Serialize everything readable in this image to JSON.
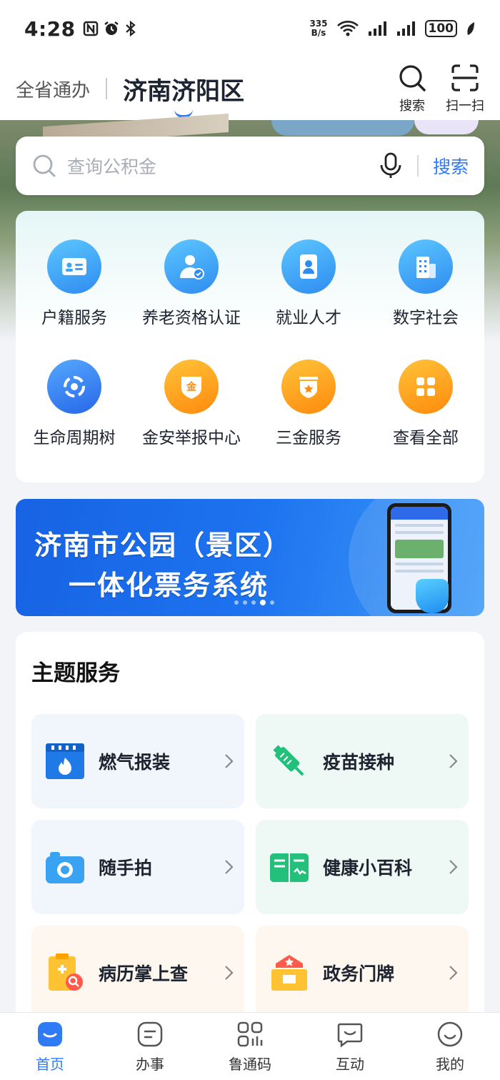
{
  "status_bar": {
    "time": "4:28",
    "net_speed_value": "335",
    "net_speed_unit": "B/s",
    "battery": "100"
  },
  "header": {
    "province_tab": "全省通办",
    "city_tab": "济南济阳区",
    "search_label": "搜索",
    "scan_label": "扫一扫"
  },
  "search": {
    "placeholder": "查询公积金",
    "button": "搜索"
  },
  "services": [
    {
      "label": "户籍服务",
      "icon": "id-card-icon"
    },
    {
      "label": "养老资格认证",
      "icon": "elder-verify-icon"
    },
    {
      "label": "就业人才",
      "icon": "badge-person-icon"
    },
    {
      "label": "数字社会",
      "icon": "building-icon"
    },
    {
      "label": "生命周期树",
      "icon": "lifecycle-icon"
    },
    {
      "label": "金安举报中心",
      "icon": "gold-shield-icon"
    },
    {
      "label": "三金服务",
      "icon": "star-shield-icon"
    },
    {
      "label": "查看全部",
      "icon": "all-grid-icon"
    }
  ],
  "banner": {
    "line1": "济南市公园（景区）",
    "line2": "一体化票务系统",
    "slide_count": 5,
    "active_slide": 4
  },
  "theme": {
    "title": "主题服务",
    "items": [
      {
        "label": "燃气报装",
        "icon": "gas-icon"
      },
      {
        "label": "疫苗接种",
        "icon": "syringe-icon"
      },
      {
        "label": "随手拍",
        "icon": "camera-icon"
      },
      {
        "label": "健康小百科",
        "icon": "health-book-icon"
      },
      {
        "label": "病历掌上查",
        "icon": "medical-record-icon"
      },
      {
        "label": "政务门牌",
        "icon": "gov-sign-icon"
      }
    ]
  },
  "bottom_nav": [
    {
      "label": "首页",
      "active": true
    },
    {
      "label": "办事",
      "active": false
    },
    {
      "label": "鲁通码",
      "active": false
    },
    {
      "label": "互动",
      "active": false
    },
    {
      "label": "我的",
      "active": false
    }
  ],
  "colors": {
    "accent": "#2f7bf5",
    "orange": "#ff8a0c",
    "green": "#22c07a"
  }
}
